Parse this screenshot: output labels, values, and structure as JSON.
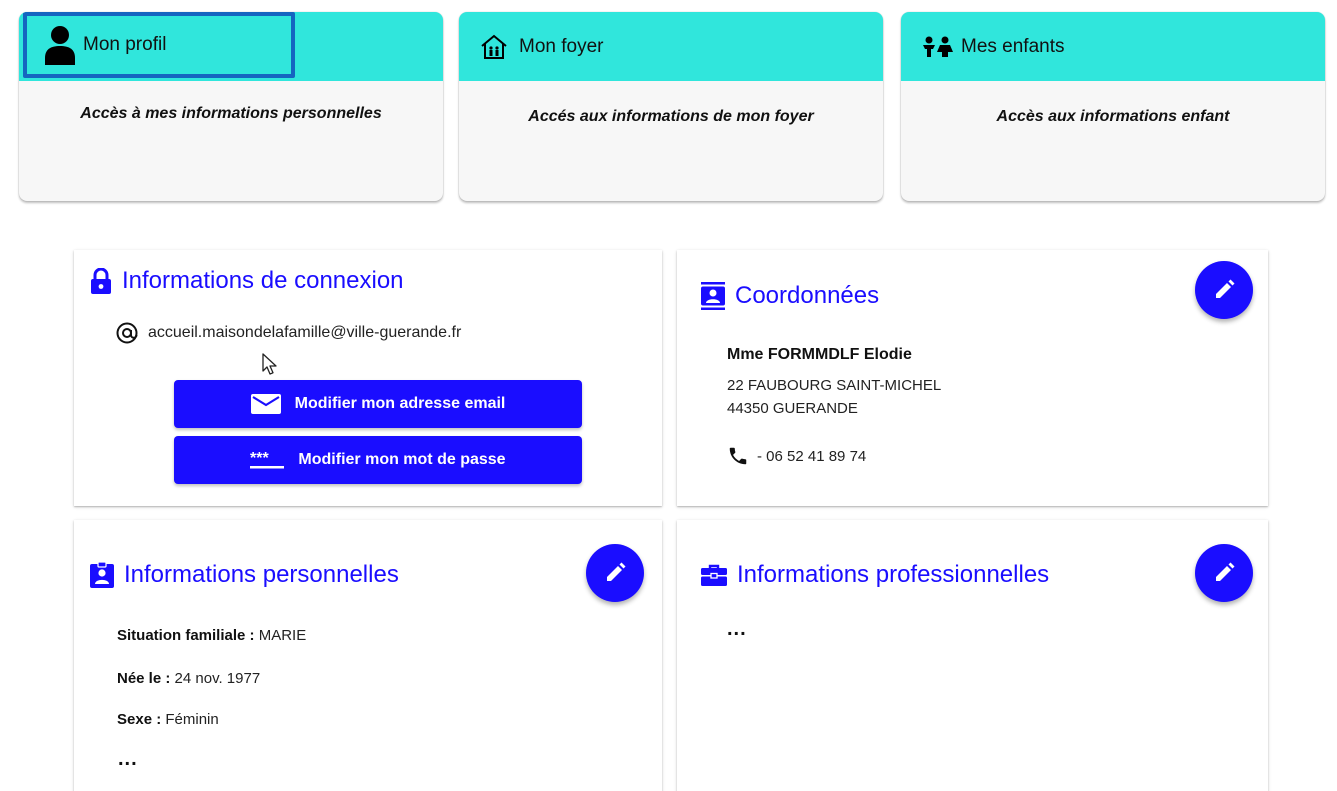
{
  "menu": {
    "profil": {
      "label": "Mon profil",
      "description": "Accès à mes informations personnelles",
      "icon": "person-icon"
    },
    "foyer": {
      "label": "Mon foyer",
      "description": "Accés aux informations de mon foyer",
      "icon": "family-home-icon"
    },
    "enfants": {
      "label": "Mes enfants",
      "description": "Accès aux informations enfant",
      "icon": "children-icon"
    }
  },
  "connexion": {
    "title": "Informations de connexion",
    "email": "accueil.maisondelafamille@ville-guerande.fr",
    "btn_email": "Modifier mon adresse email",
    "btn_password": "Modifier mon mot de passe"
  },
  "coordonnees": {
    "title": "Coordonnées",
    "name": "Mme FORMMDLF Elodie",
    "address1": "22 FAUBOURG SAINT-MICHEL",
    "address2": "44350 GUERANDE",
    "phone": "- 06 52 41 89 74"
  },
  "perso": {
    "title": "Informations personnelles",
    "situation_label": "Situation familiale :",
    "situation_value": "MARIE",
    "naissance_label": "Née le :",
    "naissance_value": "24 nov. 1977",
    "sexe_label": "Sexe :",
    "sexe_value": "Féminin",
    "more": "..."
  },
  "pro": {
    "title": "Informations professionnelles",
    "more": "..."
  },
  "colors": {
    "accent": "#1a0dff",
    "card_header": "#30e6dc",
    "focus_outline": "#1565c0"
  }
}
